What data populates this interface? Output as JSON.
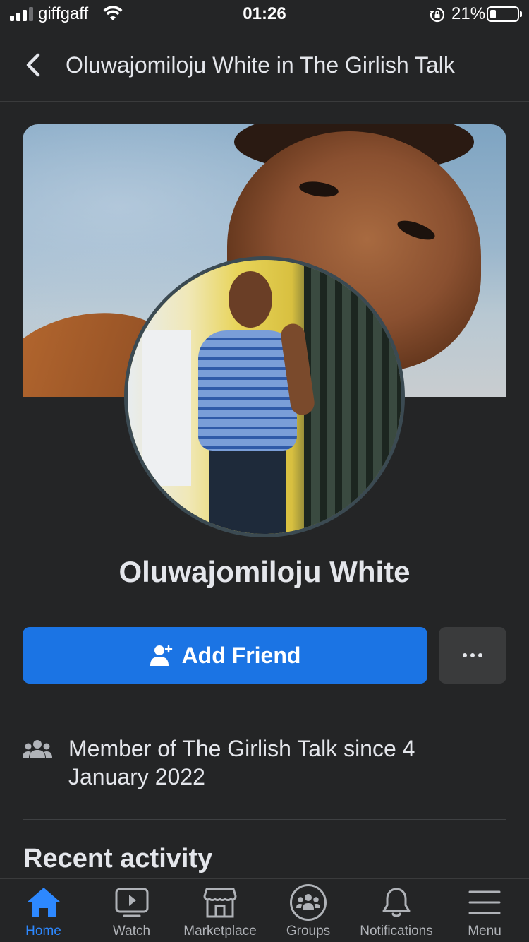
{
  "status_bar": {
    "carrier": "giffgaff",
    "time": "01:26",
    "battery": "21%",
    "battery_level": 0.21
  },
  "header": {
    "title": "Oluwajomiloju White in The Girlish Talk"
  },
  "profile": {
    "name": "Oluwajomiloju White",
    "add_friend_label": "Add Friend",
    "membership_text": "Member of ",
    "group_name": "The Girlish Talk",
    "membership_since": " since 4 January 2022"
  },
  "sections": {
    "recent_activity": "Recent activity"
  },
  "tabs": [
    {
      "label": "Home",
      "icon": "home-icon",
      "active": true
    },
    {
      "label": "Watch",
      "icon": "watch-icon",
      "active": false
    },
    {
      "label": "Marketplace",
      "icon": "marketplace-icon",
      "active": false
    },
    {
      "label": "Groups",
      "icon": "groups-icon",
      "active": false
    },
    {
      "label": "Notifications",
      "icon": "bell-icon",
      "active": false
    },
    {
      "label": "Menu",
      "icon": "menu-icon",
      "active": false
    }
  ],
  "colors": {
    "background": "#242526",
    "accent": "#1b74e4",
    "active_tab": "#2d88ff",
    "text": "#e4e6eb"
  }
}
